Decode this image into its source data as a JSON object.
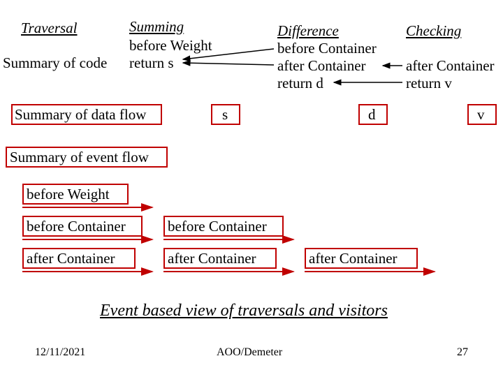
{
  "headers": {
    "traversal": "Traversal",
    "summing": "Summing",
    "difference": "Difference",
    "checking": "Checking"
  },
  "col_summing": {
    "l1": "before Weight",
    "l2": "return s"
  },
  "col_diff": {
    "l1": "before Container",
    "l2": "after Container",
    "l3": "return d"
  },
  "col_check": {
    "l1": "after Container",
    "l2": "return v"
  },
  "left_labels": {
    "summary_code": "Summary of code",
    "summary_data": "Summary of data flow",
    "summary_event": "Summary of event flow"
  },
  "flow_letters": {
    "s": "s",
    "d": "d",
    "v": "v"
  },
  "events": {
    "before_weight": "before Weight",
    "before_container_1": "before Container",
    "before_container_2": "before Container",
    "after_container_1": "after Container",
    "after_container_2": "after Container",
    "after_container_3": "after Container"
  },
  "title": "Event  based view of traversals and visitors",
  "footer": {
    "date": "12/11/2021",
    "center": "AOO/Demeter",
    "page": "27"
  }
}
